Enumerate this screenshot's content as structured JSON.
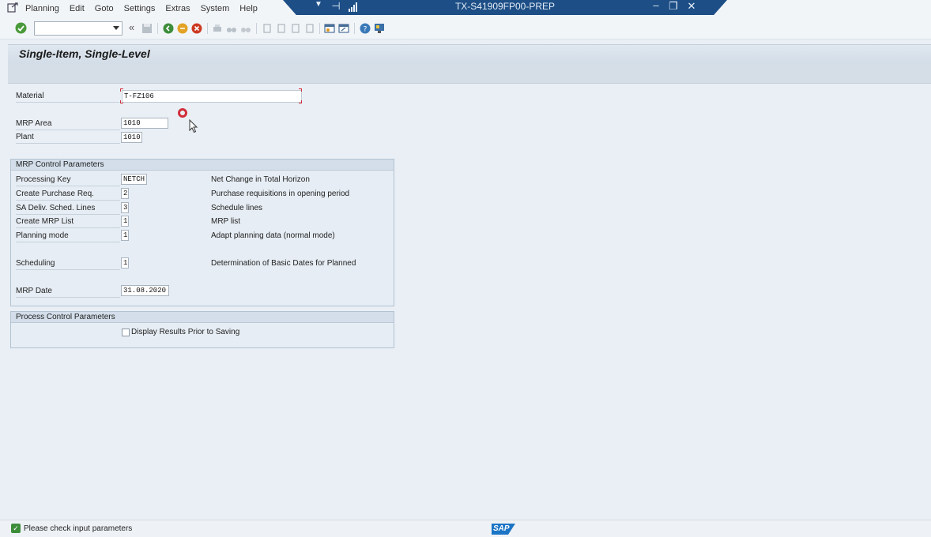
{
  "menu": {
    "items": [
      "Planning",
      "Edit",
      "Goto",
      "Settings",
      "Extras",
      "System",
      "Help"
    ]
  },
  "window": {
    "title": "TX-S41909FP00-PREP"
  },
  "toolbar": {
    "command_field": ""
  },
  "page": {
    "title": "Single-Item, Single-Level"
  },
  "form": {
    "material": {
      "label": "Material",
      "value": "T-FZ106"
    },
    "mrp_area": {
      "label": "MRP Area",
      "value": "1010"
    },
    "plant": {
      "label": "Plant",
      "value": "1010"
    }
  },
  "mrp_control": {
    "header": "MRP Control Parameters",
    "processing_key": {
      "label": "Processing Key",
      "value": "NETCH",
      "desc": "Net Change in Total Horizon"
    },
    "create_pur_req": {
      "label": "Create Purchase Req.",
      "value": "2",
      "desc": "Purchase requisitions in opening period"
    },
    "sa_deliv": {
      "label": "SA Deliv. Sched. Lines",
      "value": "3",
      "desc": "Schedule lines"
    },
    "create_mrp_list": {
      "label": "Create MRP List",
      "value": "1",
      "desc": "MRP list"
    },
    "planning_mode": {
      "label": "Planning mode",
      "value": "1",
      "desc": "Adapt planning data (normal mode)"
    },
    "scheduling": {
      "label": "Scheduling",
      "value": "1",
      "desc": "Determination of Basic Dates for Planned"
    },
    "mrp_date": {
      "label": "MRP Date",
      "value": "31.08.2020"
    }
  },
  "process_control": {
    "header": "Process Control Parameters",
    "display_results": {
      "label": "Display Results Prior to Saving",
      "checked": false
    }
  },
  "status": {
    "message": "Please check input parameters",
    "logo": "SAP"
  },
  "colors": {
    "title_bar": "#1d4e86",
    "background": "#e9eff5",
    "accent_red": "#d22d3a"
  }
}
